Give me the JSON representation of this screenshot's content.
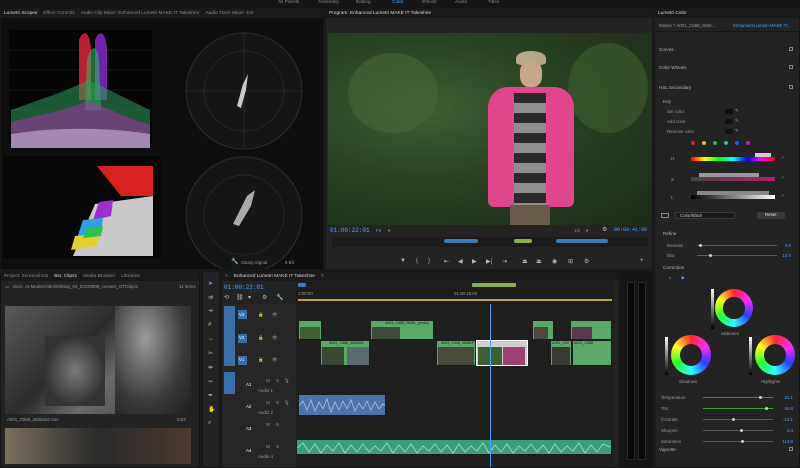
{
  "workspace_tabs": [
    {
      "label": "All Panels",
      "active": false
    },
    {
      "label": "Assembly",
      "active": false
    },
    {
      "label": "Editing",
      "active": false
    },
    {
      "label": "Color",
      "active": true
    },
    {
      "label": "Effects",
      "active": false
    },
    {
      "label": "Audio",
      "active": false
    },
    {
      "label": "Titles",
      "active": false
    }
  ],
  "top_left_panel": {
    "tabs": [
      "Lumetri Scopes",
      "Effect Controls",
      "Audio Clip Mixer: Enhanced Lumetri MAKE IT Takeshire",
      "Audio Track Mixer: Enl"
    ],
    "scope_label": "Clamp Signal",
    "scope_bit": "8 Bit"
  },
  "program_monitor": {
    "tab": "Program: Enhanced Lumetri MAKE IT Takeshire",
    "timecode": "01:00:22:01",
    "fit": "Fit",
    "quality": "1/2",
    "duration": "00:00:41:00"
  },
  "lumetri_color": {
    "tab": "Lumetri Color",
    "master": "Master * A001_C588_0606...",
    "sequence_clip": "Enhanced Lumetri MAKE IT...",
    "sections": [
      "Curves",
      "Color Wheels",
      "HSL Secondary"
    ],
    "key": {
      "title": "Key",
      "set_color": "Set color",
      "add_color": "Add color",
      "remove_color": "Remove color",
      "h": "H",
      "s": "S",
      "l": "L",
      "preview": "Color/Black",
      "reset": "Reset"
    },
    "refine": {
      "title": "Refine",
      "denoise": "Denoise",
      "denoise_val": "0.0",
      "blur": "Blur",
      "blur_val": "15.0"
    },
    "correction": {
      "title": "Correction",
      "midtones": "Midtones",
      "shadows": "Shadows",
      "highlights": "Highlights"
    },
    "adjust": [
      {
        "label": "Temperature",
        "value": "31.1",
        "pos": 0.82,
        "color": "#3a6fd0"
      },
      {
        "label": "Tint",
        "value": "50.8",
        "pos": 0.9,
        "color": "#3aa03a"
      },
      {
        "label": "Contrast",
        "value": "-13.1",
        "pos": 0.43,
        "color": "#5a5a5a"
      },
      {
        "label": "Sharpen",
        "value": "4.4",
        "pos": 0.55,
        "color": "#5a5a5a"
      },
      {
        "label": "Saturation",
        "value": "113.8",
        "pos": 0.57,
        "color": "#5a5a5a"
      }
    ],
    "vignette": "Vignette"
  },
  "project_panel": {
    "tabs": [
      "Project: Screenshots",
      "Bin: Clips1",
      "Media Browser",
      "Libraries"
    ],
    "path": "Scre...rs Media\\Video\\MI\\Day_03_20150808_convert_OT\\Clips1",
    "count": "11 Items",
    "clip1_name": "A001_C588_0606SM.mov",
    "clip1_dur": "0:03"
  },
  "timeline": {
    "tab": "Enhanced Lumetri MAKE IT Takeshire",
    "timecode": "01:00:22:01",
    "ruler_start": "1:00:00",
    "ruler_mid": "01:00:15:00",
    "tracks": [
      {
        "name": "V3"
      },
      {
        "name": "V2"
      },
      {
        "name": "V1"
      },
      {
        "name": "A1",
        "label": "Audio 1"
      },
      {
        "name": "A2",
        "label": "Audio 2"
      },
      {
        "name": "A3"
      },
      {
        "name": "A4",
        "label": "Audio 4"
      }
    ],
    "clip_labels": [
      "A001_C588_0606SM",
      "A001_C588_0606L_prodos",
      "A003_C008_0808LP",
      "A001_C588",
      "A002_C00"
    ]
  },
  "colors": {
    "accent": "#4aa3ff",
    "clip_green": "#5aa86a",
    "audio_blue": "#4c74a8",
    "audio_green": "#3c9c7c"
  }
}
